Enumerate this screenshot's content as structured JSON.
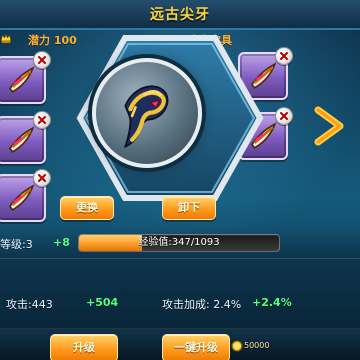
{
  "header": {
    "title": "远古尖牙"
  },
  "top_labels": {
    "potential": "潜力 100",
    "slot_label": "攻击宝具"
  },
  "buttons": {
    "replace": "更换",
    "unequip": "卸下",
    "upgrade": "升级",
    "one_click_upgrade": "一键升级"
  },
  "stats": {
    "level": "等级:3",
    "level_plus": "+8",
    "exp_text": "经验值:347/1093",
    "exp_progress": 0.317,
    "attack": "攻击:443",
    "attack_plus": "+504",
    "attack_bonus": "攻击加成: 2.4%",
    "attack_bonus_plus": "+2.4%"
  },
  "currency": {
    "gold_value": "50000"
  },
  "colors": {
    "title": "#ffd43a",
    "orange_label": "#ffb033",
    "green_plus": "#58ff7c",
    "button_orange": "#ff9a1e",
    "slot_purple": "#7f5bc0"
  },
  "icons": {
    "crown": "crown-icon",
    "slot_item": "fang-item-icon",
    "close": "close-icon",
    "arrow": "arrow-right-icon",
    "gold": "gold-coin-icon"
  }
}
